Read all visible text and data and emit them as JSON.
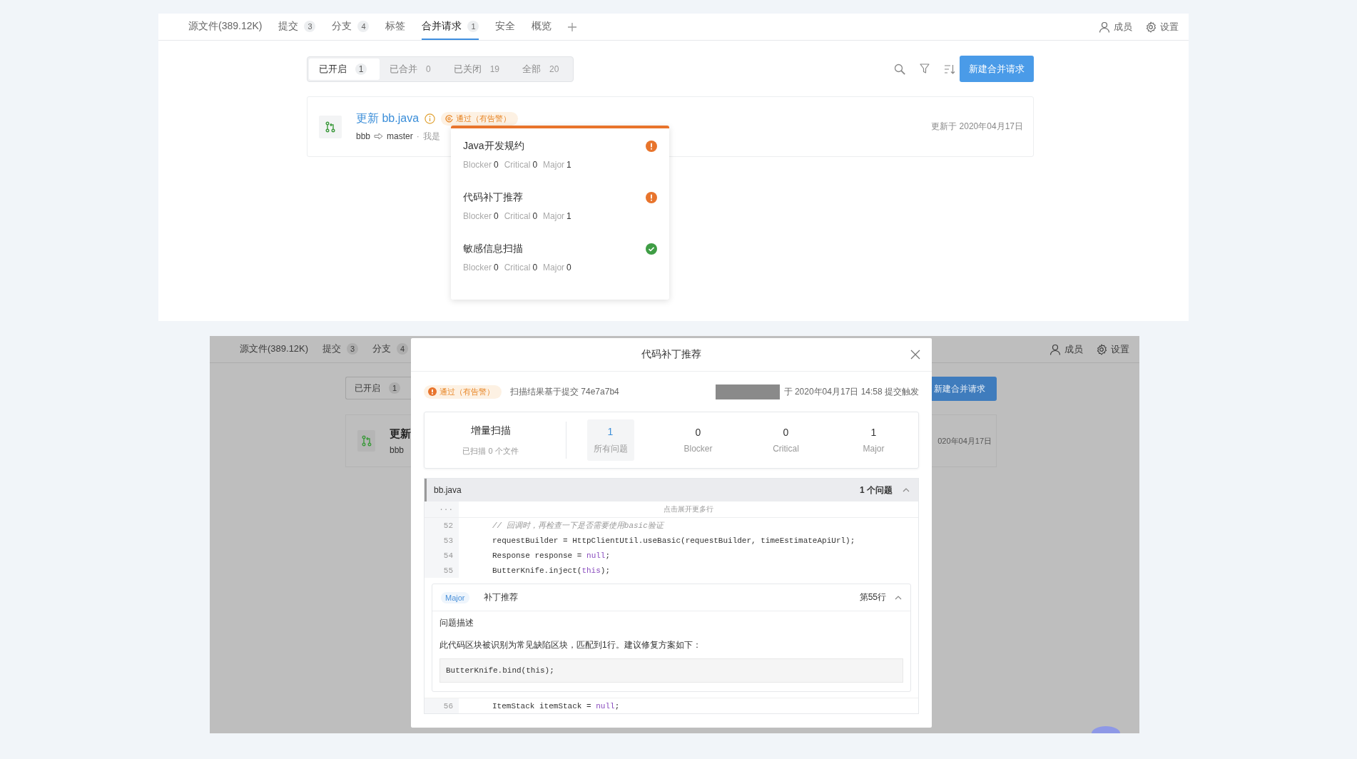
{
  "top_view": {
    "tabs": [
      {
        "label": "源文件(389.12K)",
        "selected": false
      },
      {
        "label": "提交",
        "count": "3",
        "selected": false
      },
      {
        "label": "分支",
        "count": "4",
        "selected": false
      },
      {
        "label": "标签",
        "selected": false
      },
      {
        "label": "合并请求",
        "count": "1",
        "selected": true
      },
      {
        "label": "安全",
        "selected": false
      },
      {
        "label": "概览",
        "selected": false
      }
    ],
    "header_actions": [
      {
        "kind": "members",
        "label": "成员"
      },
      {
        "kind": "settings",
        "label": "设置"
      }
    ],
    "state_filter": [
      {
        "label": "已开启",
        "count": "1",
        "selected": true
      },
      {
        "label": "已合并",
        "count": "0",
        "selected": false
      },
      {
        "label": "已关闭",
        "count": "19",
        "selected": false
      },
      {
        "label": "全部",
        "count": "20",
        "selected": false
      }
    ],
    "new_button": "新建合并请求",
    "merge_request": {
      "title": "更新 bb.java",
      "status": "通过（有告警）",
      "source": "bbb",
      "target": "master",
      "separator": "·",
      "description": "我是",
      "updated": "更新于 2020年04月17日"
    },
    "scan_popup": [
      {
        "name": "Java开发规约",
        "kind": "warning",
        "counts": [
          {
            "label": "Blocker",
            "value": "0"
          },
          {
            "label": "Critical",
            "value": "0"
          },
          {
            "label": "Major",
            "value": "1"
          }
        ]
      },
      {
        "name": "代码补丁推荐",
        "kind": "warning",
        "counts": [
          {
            "label": "Blocker",
            "value": "0"
          },
          {
            "label": "Critical",
            "value": "0"
          },
          {
            "label": "Major",
            "value": "1"
          }
        ]
      },
      {
        "name": "敏感信息扫描",
        "kind": "passed",
        "counts": [
          {
            "label": "Blocker",
            "value": "0"
          },
          {
            "label": "Critical",
            "value": "0"
          },
          {
            "label": "Major",
            "value": "0"
          }
        ]
      }
    ]
  },
  "bottom_view": {
    "tabs": [
      {
        "label": "源文件(389.12K)",
        "selected": false
      },
      {
        "label": "提交",
        "count": "3",
        "selected": false
      },
      {
        "label": "分支",
        "count": "4",
        "selected": false
      }
    ],
    "header_actions": [
      {
        "kind": "members",
        "label": "成员"
      },
      {
        "kind": "settings",
        "label": "设置"
      }
    ],
    "state_filter": [
      {
        "label": "已开启",
        "count": "1"
      }
    ],
    "new_button": "新建合并请求",
    "merge_request": {
      "title": "更新",
      "source": "bbb",
      "updated": "020年04月17日"
    },
    "dialog": {
      "title": "代码补丁推荐",
      "status": "通过（有告警）",
      "commit_note": "扫描结果基于提交 74e7a7b4",
      "trigger_note": "于 2020年04月17日 14:58 提交触发",
      "scan_type": "增量扫描",
      "scanned_files": "已扫描 0 个文件",
      "stats": [
        {
          "value": "1",
          "label": "所有问题",
          "selected": true
        },
        {
          "value": "0",
          "label": "Blocker",
          "selected": false
        },
        {
          "value": "0",
          "label": "Critical",
          "selected": false
        },
        {
          "value": "1",
          "label": "Major",
          "selected": false
        }
      ],
      "file": {
        "name": "bb.java",
        "issue_count": "1 个问题",
        "expanded": true,
        "expand_gutter": "···",
        "expand_hint": "点击展开更多行",
        "code_before": [
          {
            "number": "52",
            "tokens": [
              {
                "kind": "comment",
                "text": "// 回调时，再检查一下是否需要使用basic验证"
              }
            ]
          },
          {
            "number": "53",
            "tokens": [
              {
                "kind": "plain",
                "text": "requestBuilder = HttpClientUtil.useBasic(requestBuilder, timeEstimateApiUrl);"
              }
            ]
          },
          {
            "number": "54",
            "tokens": [
              {
                "kind": "plain",
                "text": "Response response = "
              },
              {
                "kind": "keyword",
                "text": "null"
              },
              {
                "kind": "plain",
                "text": ";"
              }
            ]
          },
          {
            "number": "55",
            "tokens": [
              {
                "kind": "plain",
                "text": "ButterKnife.inject("
              },
              {
                "kind": "keyword",
                "text": "this"
              },
              {
                "kind": "plain",
                "text": ");"
              }
            ]
          }
        ],
        "issue": {
          "severity": "Major",
          "title": "补丁推荐",
          "line": "第55行",
          "expanded": true,
          "heading": "问题描述",
          "description": "此代码区块被识别为常见缺陷区块，匹配到1行。建议修复方案如下：",
          "fix": "ButterKnife.bind(this);"
        },
        "code_after": [
          {
            "number": "56",
            "tokens": [
              {
                "kind": "plain",
                "text": "ItemStack itemStack = "
              },
              {
                "kind": "keyword",
                "text": "null"
              },
              {
                "kind": "plain",
                "text": ";"
              }
            ]
          }
        ]
      }
    }
  }
}
